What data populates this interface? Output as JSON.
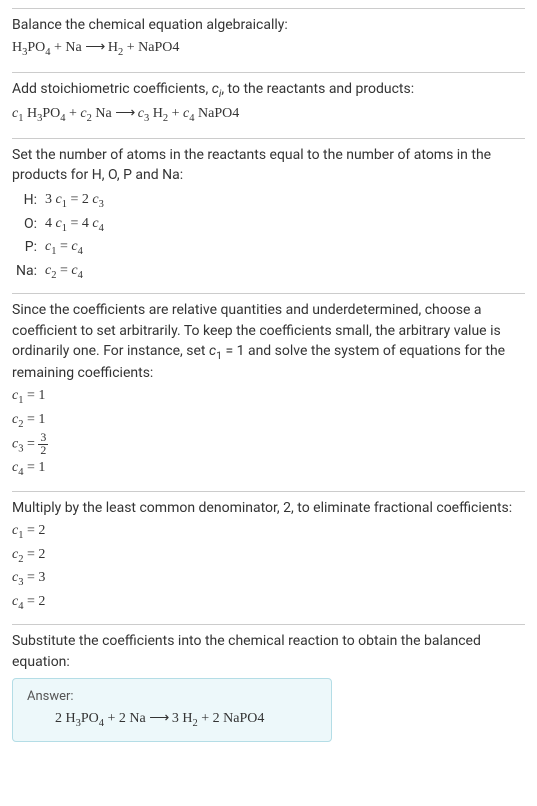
{
  "section1": {
    "intro": "Balance the chemical equation algebraically:",
    "equation": "H₃PO₄ + Na ⟶ H₂ + NaPO4"
  },
  "section2": {
    "intro": "Add stoichiometric coefficients, ",
    "ci": "cᵢ",
    "intro2": ", to the reactants and products:",
    "equation_parts": {
      "c1": "c₁",
      "r1": " H₃PO₄ + ",
      "c2": "c₂",
      "r2": " Na ⟶ ",
      "c3": "c₃",
      "r3": " H₂ + ",
      "c4": "c₄",
      "r4": " NaPO4"
    }
  },
  "section3": {
    "intro": "Set the number of atoms in the reactants equal to the number of atoms in the products for H, O, P and Na:",
    "rows": [
      {
        "el": "H:",
        "eq_left": "3 c₁",
        "eq_mid": " = ",
        "eq_right": "2 c₃"
      },
      {
        "el": "O:",
        "eq_left": "4 c₁",
        "eq_mid": " = ",
        "eq_right": "4 c₄"
      },
      {
        "el": "P:",
        "eq_left": "c₁",
        "eq_mid": " = ",
        "eq_right": "c₄"
      },
      {
        "el": "Na:",
        "eq_left": "c₂",
        "eq_mid": " = ",
        "eq_right": "c₄"
      }
    ]
  },
  "section4": {
    "intro": "Since the coefficients are relative quantities and underdetermined, choose a coefficient to set arbitrarily. To keep the coefficients small, the arbitrary value is ordinarily one. For instance, set c₁ = 1 and solve the system of equations for the remaining coefficients:",
    "coefs": {
      "c1": "c₁ = 1",
      "c2": "c₂ = 1",
      "c3_left": "c₃ = ",
      "c3_num": "3",
      "c3_den": "2",
      "c4": "c₄ = 1"
    }
  },
  "section5": {
    "intro": "Multiply by the least common denominator, 2, to eliminate fractional coefficients:",
    "coefs": [
      "c₁ = 2",
      "c₂ = 2",
      "c₃ = 3",
      "c₄ = 2"
    ]
  },
  "section6": {
    "intro": "Substitute the coefficients into the chemical reaction to obtain the balanced equation:"
  },
  "answer": {
    "label": "Answer:",
    "equation": "2 H₃PO₄ + 2 Na ⟶ 3 H₂ + 2 NaPO4"
  },
  "chart_data": {
    "type": "table",
    "title": "Balancing chemical equation algebraically",
    "unbalanced_equation": "H3PO4 + Na -> H2 + NaPO4",
    "atom_balance_equations": [
      {
        "element": "H",
        "equation": "3 c1 = 2 c3"
      },
      {
        "element": "O",
        "equation": "4 c1 = 4 c4"
      },
      {
        "element": "P",
        "equation": "c1 = c4"
      },
      {
        "element": "Na",
        "equation": "c2 = c4"
      }
    ],
    "initial_solution": {
      "c1": 1,
      "c2": 1,
      "c3": 1.5,
      "c4": 1
    },
    "scaled_solution": {
      "c1": 2,
      "c2": 2,
      "c3": 3,
      "c4": 2
    },
    "balanced_equation": "2 H3PO4 + 2 Na -> 3 H2 + 2 NaPO4"
  }
}
